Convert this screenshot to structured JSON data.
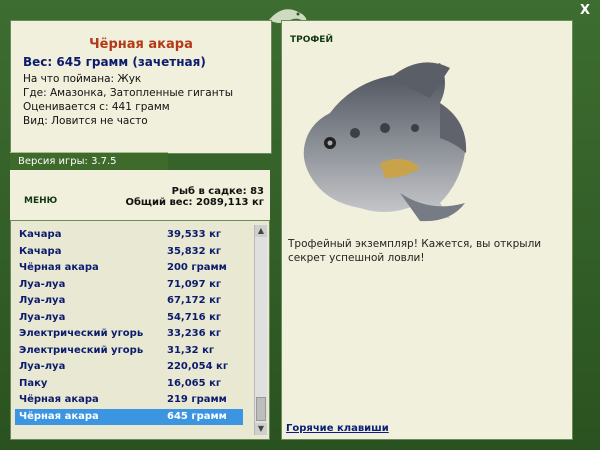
{
  "fish": {
    "name": "Чёрная акара",
    "weight": "Вес: 645 грамм (зачетная)",
    "bait": "На что поймана: Жук",
    "location": "Где: Амазонка, Затопленные гиганты",
    "value": "Оценивается с: 441 грамм",
    "type": "Вид: Ловится не часто"
  },
  "version": "Версия игры: 3.7.5",
  "menu_label": "МЕНЮ",
  "stats": {
    "in_cage": "Рыб в садке: 83",
    "total_weight": "Общий вес: 2089,113 кг"
  },
  "catch_list": [
    {
      "name": "Качара",
      "weight": "39,533 кг"
    },
    {
      "name": "Качара",
      "weight": "35,832 кг"
    },
    {
      "name": "Чёрная акара",
      "weight": "200 грамм"
    },
    {
      "name": "Луа-луа",
      "weight": "71,097 кг"
    },
    {
      "name": "Луа-луа",
      "weight": "67,172 кг"
    },
    {
      "name": "Луа-луа",
      "weight": "54,716 кг"
    },
    {
      "name": "Электрический угорь",
      "weight": "33,236 кг"
    },
    {
      "name": "Электрический угорь",
      "weight": "31,32 кг"
    },
    {
      "name": "Луа-луа",
      "weight": "220,054 кг"
    },
    {
      "name": "Паку",
      "weight": "16,065 кг"
    },
    {
      "name": "Чёрная акара",
      "weight": "219 грамм"
    },
    {
      "name": "Чёрная акара",
      "weight": "645 грамм"
    }
  ],
  "selected_row": 11,
  "trophy_label": "ТРОФЕЙ",
  "trophy_text": "Трофейный экземпляр! Кажется, вы открыли секрет успешной ловли!",
  "hotkeys_label": "Горячие клавиши",
  "close_label": "X",
  "colors": {
    "frame": "#2f5a25",
    "panel": "#f1f0dc",
    "selection": "#3b95e0",
    "title": "#b33a18",
    "text_blue": "#0c1c6d"
  }
}
